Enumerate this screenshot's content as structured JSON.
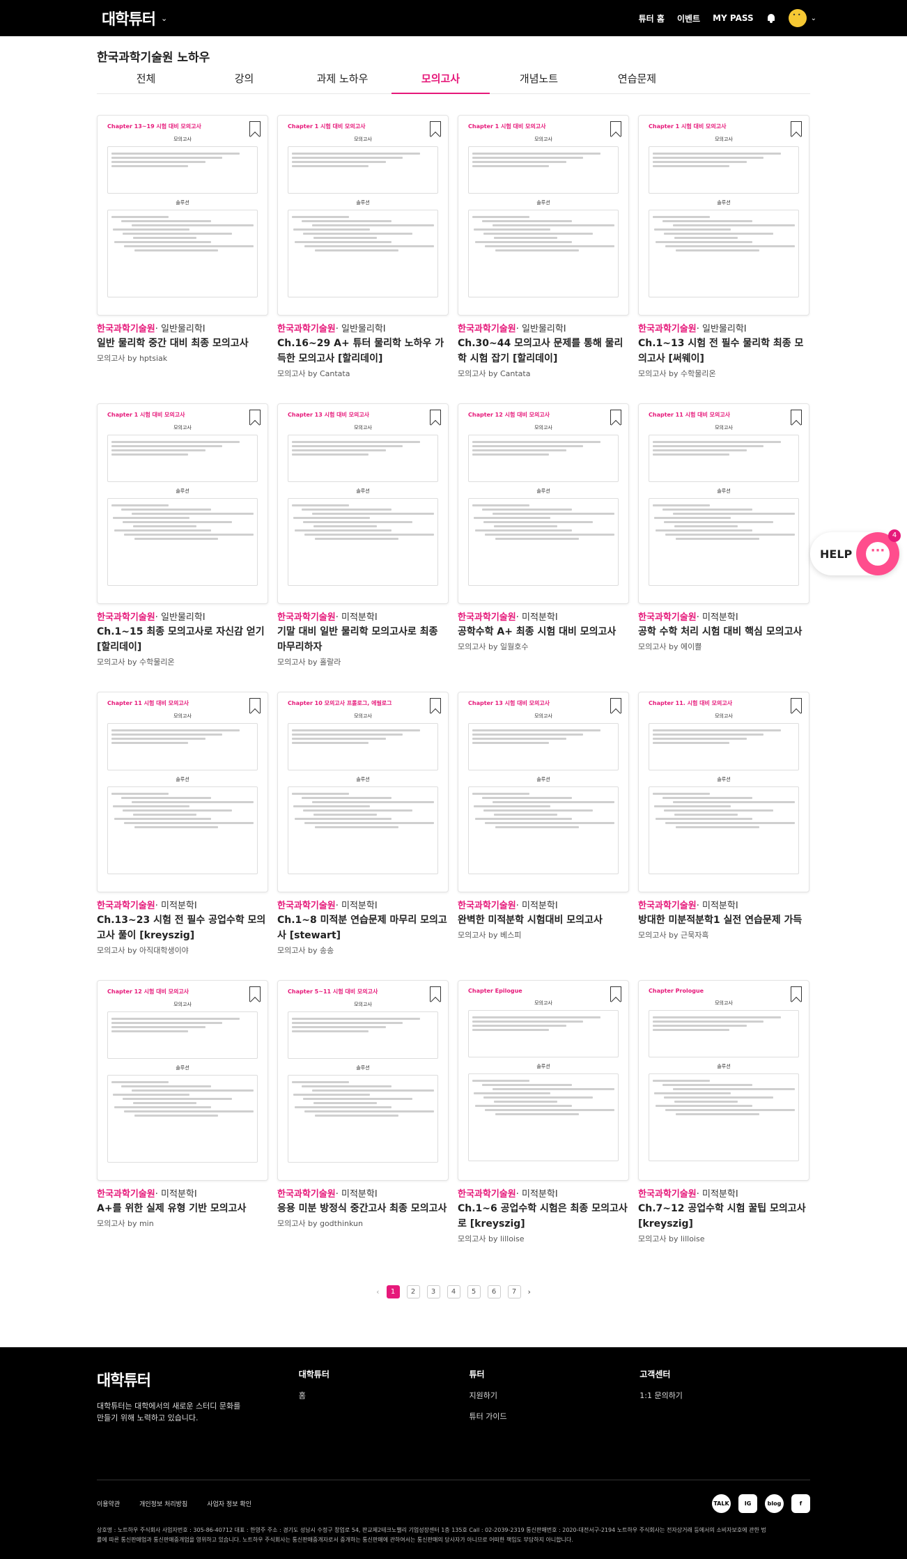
{
  "header": {
    "logo": "대학튜터",
    "nav": [
      "튜터 홈",
      "이벤트",
      "MY PASS"
    ]
  },
  "page": {
    "title": "한국과학기술원 노하우",
    "tabs": [
      "전체",
      "강의",
      "과제 노하우",
      "모의고사",
      "개념노트",
      "연습문제"
    ],
    "active_tab": "모의고사"
  },
  "cards": [
    {
      "chapter": "Chapter 13~19 시험 대비 모의고사",
      "school": "한국과학기술원",
      "subject": "· 일반물리학I",
      "title": "일반 물리학 중간 대비 최종 모의고사",
      "author": "모의고사 by hptsiak"
    },
    {
      "chapter": "Chapter 1 시험 대비 모의고사",
      "school": "한국과학기술원",
      "subject": "· 일반물리학I",
      "title": "Ch.16~29 A+ 튜터 물리학 노하우 가득한 모의고사 [할리데이]",
      "author": "모의고사 by Cantata"
    },
    {
      "chapter": "Chapter 1 시험 대비 모의고사",
      "school": "한국과학기술원",
      "subject": "· 일반물리학I",
      "title": "Ch.30~44 모의고사 문제를 통해 물리학 시험 잡기 [할리데이]",
      "author": "모의고사 by Cantata"
    },
    {
      "chapter": "Chapter 1 시험 대비 모의고사",
      "school": "한국과학기술원",
      "subject": "· 일반물리학I",
      "title": "Ch.1~13 시험 전 필수 물리학 최종 모의고사 [써웨이]",
      "author": "모의고사 by 수학물리온"
    },
    {
      "chapter": "Chapter 1 시험 대비 모의고사",
      "school": "한국과학기술원",
      "subject": "· 일반물리학I",
      "title": "Ch.1~15 최종 모의고사로 자신감 얻기 [할리데이]",
      "author": "모의고사 by 수학물리온"
    },
    {
      "chapter": "Chapter 13 시험 대비 모의고사",
      "school": "한국과학기술원",
      "subject": "· 미적분학I",
      "title": "기말 대비 일반 물리학 모의고사로 최종 마무리하자",
      "author": "모의고사 by 홀랄라"
    },
    {
      "chapter": "Chapter 12 시험 대비 모의고사",
      "school": "한국과학기술원",
      "subject": "· 미적분학I",
      "title": "공학수학 A+ 최종 시험 대비 모의고사",
      "author": "모의고사 by 일월호수"
    },
    {
      "chapter": "Chapter 11 시험 대비 모의고사",
      "school": "한국과학기술원",
      "subject": "· 미적분학I",
      "title": "공학 수학 처리 시험 대비 핵심 모의고사",
      "author": "모의고사 by 에이쁠"
    },
    {
      "chapter": "Chapter 11 시험 대비 모의고사",
      "school": "한국과학기술원",
      "subject": "· 미적분학I",
      "title": "Ch.13~23 시험 전 필수 공업수학 모의고사 풀이 [kreyszig]",
      "author": "모의고사 by 아직대학생이야"
    },
    {
      "chapter": "Chapter 10 모의고사 프롤로그, 에필로그",
      "school": "한국과학기술원",
      "subject": "· 미적분학I",
      "title": "Ch.1~8 미적분 연습문제 마무리 모의고사 [stewart]",
      "author": "모의고사 by 송송"
    },
    {
      "chapter": "Chapter 13 시험 대비 모의고사",
      "school": "한국과학기술원",
      "subject": "· 미적분학I",
      "title": "완벽한 미적분학 시험대비 모의고사",
      "author": "모의고사 by 베스피"
    },
    {
      "chapter": "Chapter 11. 시험 대비 모의고사",
      "school": "한국과학기술원",
      "subject": "· 미적분학I",
      "title": "방대한 미분적분학1 실전 연습문제 가득",
      "author": "모의고사 by 근묵자흑"
    },
    {
      "chapter": "Chapter 12 시험 대비 모의고사",
      "school": "한국과학기술원",
      "subject": "· 미적분학I",
      "title": "A+를 위한 실제 유형 기반 모의고사",
      "author": "모의고사 by min"
    },
    {
      "chapter": "Chapter 5~11 시험 대비 모의고사",
      "school": "한국과학기술원",
      "subject": "· 미적분학I",
      "title": "응용 미분 방정식 중간고사 최종 모의고사",
      "author": "모의고사 by godthinkun"
    },
    {
      "chapter": "Chapter Epilogue",
      "school": "한국과학기술원",
      "subject": "· 미적분학I",
      "title": "Ch.1~6 공업수학 시험은 최종 모의고사로 [kreyszig]",
      "author": "모의고사 by lilloise"
    },
    {
      "chapter": "Chapter Prologue",
      "school": "한국과학기술원",
      "subject": "· 미적분학I",
      "title": "Ch.7~12 공업수학 시험 꿀팁 모의고사 [kreyszig]",
      "author": "모의고사 by lilloise"
    }
  ],
  "thumb_labels": {
    "exam": "모의고사",
    "solution": "솔루션"
  },
  "pagination": {
    "pages": [
      "1",
      "2",
      "3",
      "4",
      "5",
      "6",
      "7"
    ],
    "current": "1"
  },
  "help": {
    "label": "HELP",
    "badge": "4"
  },
  "footer": {
    "logo": "대학튜터",
    "desc1": "대학튜터는 대학에서의 새로운 스터디 문화를",
    "desc2": "만들기 위해 노력하고 있습니다.",
    "columns": [
      {
        "head": "대학튜터",
        "links": [
          "홈"
        ]
      },
      {
        "head": "튜터",
        "links": [
          "지원하기",
          "튜터 가이드"
        ]
      },
      {
        "head": "고객센터",
        "links": [
          "1:1 문의하기"
        ]
      }
    ],
    "bottom_links": [
      "이용약관",
      "개인정보 처리방침",
      "사업자 정보 확인"
    ],
    "socials": [
      "TALK",
      "IG",
      "blog",
      "f"
    ],
    "legal1": "상호명 : 노트하우 주식회사 사업자번호 : 305-86-40712 대표 : 한영주 주소 : 경기도 성남시 수정구 창업로 54, 판교제2테크노밸리 기업성장센터 1층 135호 Call : 02-2039-2319 통신판매번호 : 2020-대전서구-2194 노트하우 주식회사는 전자상거래 등에서의 소비자보호에 관한 법",
    "legal2": "률에 따른 통신판매업과 통신판매중개업을 영위하고 있습니다. 노트하우 주식회사는 통신판매중개자로서 중개하는 통신판매에 관하여서는 통신판매의 당사자가 아니므로 어떠한 책임도 부담하지 아니합니다."
  }
}
